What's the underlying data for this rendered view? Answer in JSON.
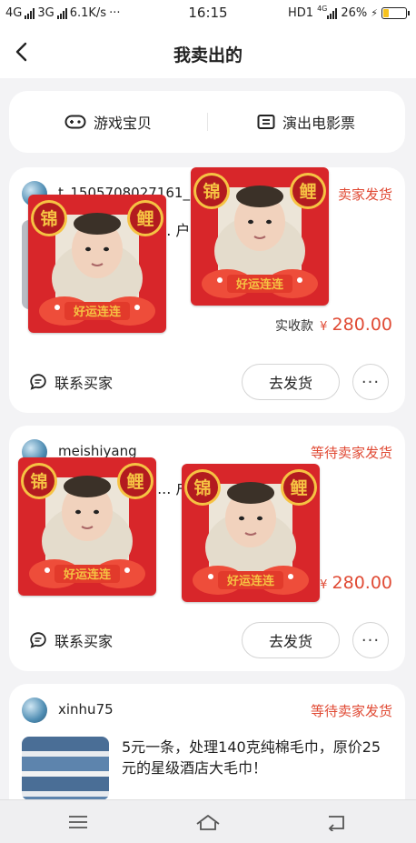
{
  "status_bar": {
    "network_left": "4G",
    "network_mid": "3G",
    "speed": "6.1K/s",
    "dots": "···",
    "time": "16:15",
    "hd": "HD1",
    "net_small": "4G",
    "battery_pct": "26%",
    "battery_level": 0.26,
    "battery_color": "#f7c21d"
  },
  "nav": {
    "title": "我卖出的",
    "back_icon": "chevron-left-icon"
  },
  "categories": [
    {
      "label": "游戏宝贝",
      "icon": "gamepad-icon"
    },
    {
      "label": "演出电影票",
      "icon": "ticket-icon"
    }
  ],
  "orders": [
    {
      "seller": "t_1505708027161_",
      "status": "卖家发货",
      "desc": "处理 ... 户外庭院 用超",
      "price_label": "实收款",
      "price_symbol": "¥",
      "price": "280.00",
      "contact_label": "联系买家",
      "ship_label": "去发货",
      "more_label": "···"
    },
    {
      "seller": "meishiyang",
      "status": "等待卖家发货",
      "desc": "处理 ... 户外庭院 用超",
      "price_label": "",
      "price_symbol": "¥",
      "price": "280.00",
      "contact_label": "联系买家",
      "ship_label": "去发货",
      "more_label": "···"
    },
    {
      "seller": "xinhu75",
      "status": "等待卖家发货",
      "desc": "5元一条，处理140克纯棉毛巾，原价25元的星级酒店大毛巾！"
    }
  ],
  "sticker": {
    "left_char": "锦",
    "right_char": "鲤",
    "banner": "好运连连",
    "colors": {
      "red": "#d8262a",
      "gold": "#f6c343",
      "fish": "#ee4d3a"
    }
  },
  "colors": {
    "accent": "#e04a34",
    "background": "#f3f3f5"
  },
  "system_nav": [
    "menu-icon",
    "home-icon",
    "back-icon"
  ]
}
